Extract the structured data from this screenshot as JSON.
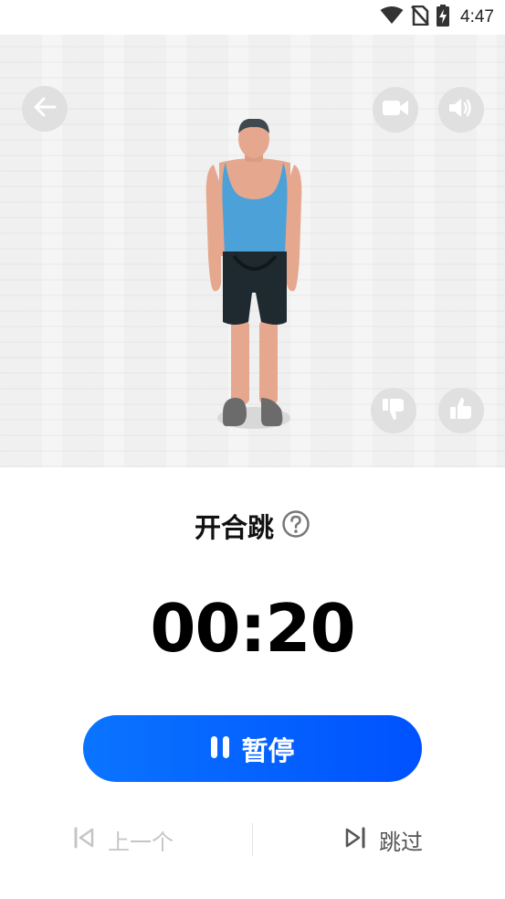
{
  "status_bar": {
    "time": "4:47",
    "icons": [
      "wifi-icon",
      "no-sim-icon",
      "battery-charging-icon"
    ]
  },
  "video": {
    "icons": {
      "back": "back-arrow-icon",
      "video": "video-camera-icon",
      "sound": "speaker-icon",
      "dislike": "thumbs-down-icon",
      "like": "thumbs-up-icon"
    }
  },
  "exercise": {
    "title": "开合跳",
    "help_icon": "question-circle-icon"
  },
  "timer": {
    "display": "00:20"
  },
  "pause_button": {
    "label": "暂停",
    "icon": "pause-icon"
  },
  "navigation": {
    "previous_label": "上一个",
    "skip_label": "跳过"
  },
  "colors": {
    "primary_start": "#0a74ff",
    "primary_end": "#0052ff",
    "disabled_text": "#c5c5c5",
    "secondary_text": "#555555"
  }
}
